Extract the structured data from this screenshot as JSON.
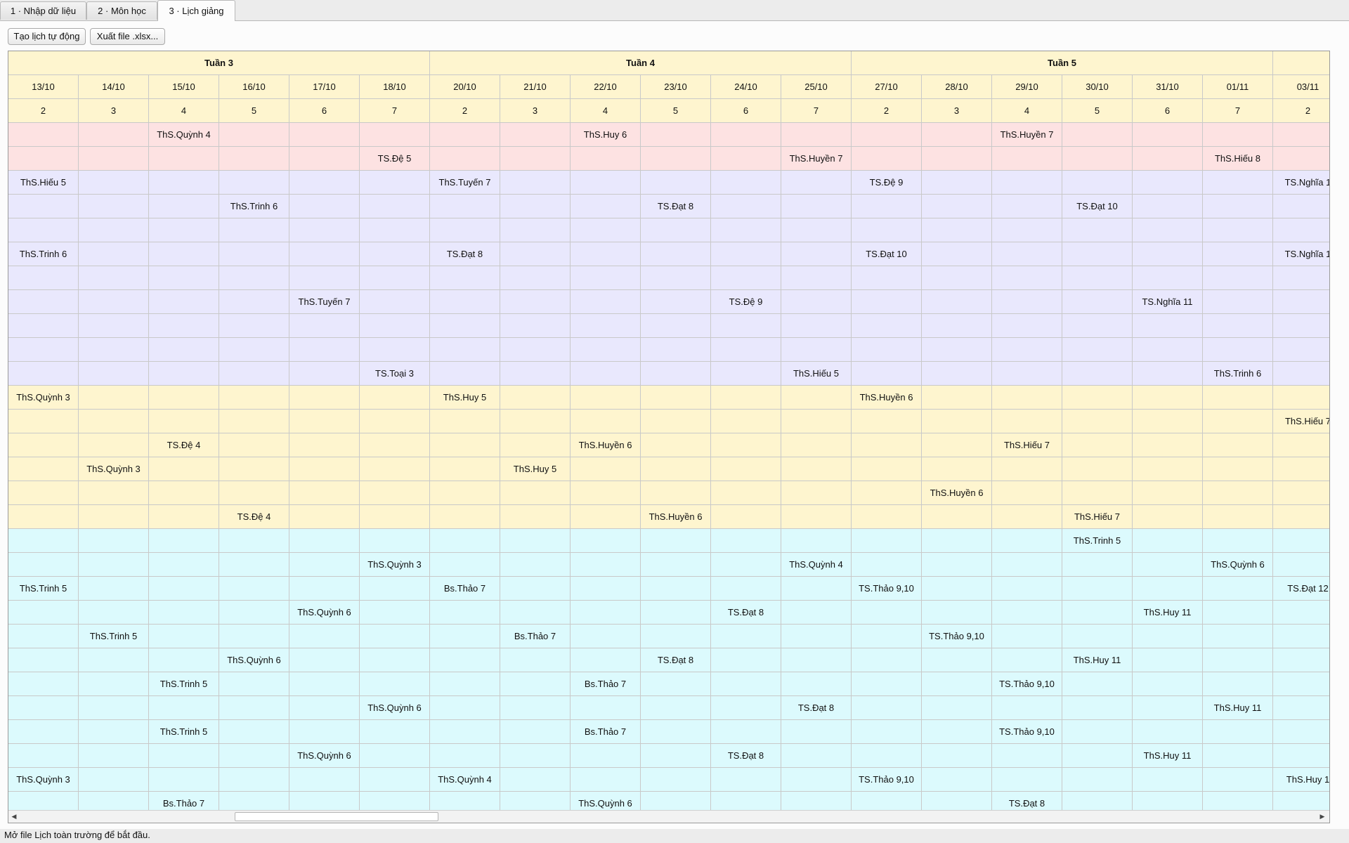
{
  "tabs": [
    {
      "label": "1 · Nhập dữ liệu",
      "active": false
    },
    {
      "label": "2 · Môn học",
      "active": false
    },
    {
      "label": "3 · Lịch giảng",
      "active": true
    }
  ],
  "toolbar": {
    "generate_label": "Tạo lịch tự động",
    "export_label": "Xuất file .xlsx..."
  },
  "schedule": {
    "weeks": [
      "Tuần 3",
      "Tuần 4",
      "Tuần 5"
    ],
    "columns": [
      {
        "date": "13/10",
        "day": "2"
      },
      {
        "date": "14/10",
        "day": "3"
      },
      {
        "date": "15/10",
        "day": "4"
      },
      {
        "date": "16/10",
        "day": "5"
      },
      {
        "date": "17/10",
        "day": "6"
      },
      {
        "date": "18/10",
        "day": "7"
      },
      {
        "date": "20/10",
        "day": "2"
      },
      {
        "date": "21/10",
        "day": "3"
      },
      {
        "date": "22/10",
        "day": "4"
      },
      {
        "date": "23/10",
        "day": "5"
      },
      {
        "date": "24/10",
        "day": "6"
      },
      {
        "date": "25/10",
        "day": "7"
      },
      {
        "date": "27/10",
        "day": "2"
      },
      {
        "date": "28/10",
        "day": "3"
      },
      {
        "date": "29/10",
        "day": "4"
      },
      {
        "date": "30/10",
        "day": "5"
      },
      {
        "date": "31/10",
        "day": "6"
      },
      {
        "date": "01/11",
        "day": "7"
      },
      {
        "date": "03/11",
        "day": "2"
      }
    ],
    "row_groups": [
      {
        "color": "#fde2e2",
        "rows": [
          [
            "",
            "",
            "ThS.Quỳnh 4",
            "",
            "",
            "",
            "",
            "",
            "ThS.Huy 6",
            "",
            "",
            "",
            "",
            "",
            "ThS.Huyền 7",
            "",
            "",
            "",
            ""
          ],
          [
            "",
            "",
            "",
            "",
            "",
            "TS.Đệ 5",
            "",
            "",
            "",
            "",
            "",
            "ThS.Huyền 7",
            "",
            "",
            "",
            "",
            "",
            "ThS.Hiếu 8",
            ""
          ]
        ]
      },
      {
        "color": "#e9e8fd",
        "rows": [
          [
            "ThS.Hiếu 5",
            "",
            "",
            "",
            "",
            "",
            "ThS.Tuyến 7",
            "",
            "",
            "",
            "",
            "",
            "TS.Đệ 9",
            "",
            "",
            "",
            "",
            "",
            "TS.Nghĩa 1"
          ],
          [
            "",
            "",
            "",
            "ThS.Trinh 6",
            "",
            "",
            "",
            "",
            "",
            "TS.Đạt 8",
            "",
            "",
            "",
            "",
            "",
            "TS.Đạt 10",
            "",
            "",
            ""
          ],
          [
            "",
            "",
            "",
            "",
            "",
            "",
            "",
            "",
            "",
            "",
            "",
            "",
            "",
            "",
            "",
            "",
            "",
            "",
            ""
          ],
          [
            "ThS.Trinh 6",
            "",
            "",
            "",
            "",
            "",
            "TS.Đạt 8",
            "",
            "",
            "",
            "",
            "",
            "TS.Đạt 10",
            "",
            "",
            "",
            "",
            "",
            "TS.Nghĩa 1"
          ],
          [
            "",
            "",
            "",
            "",
            "",
            "",
            "",
            "",
            "",
            "",
            "",
            "",
            "",
            "",
            "",
            "",
            "",
            "",
            ""
          ],
          [
            "",
            "",
            "",
            "",
            "ThS.Tuyến 7",
            "",
            "",
            "",
            "",
            "",
            "TS.Đệ 9",
            "",
            "",
            "",
            "",
            "",
            "TS.Nghĩa 11",
            "",
            ""
          ],
          [
            "",
            "",
            "",
            "",
            "",
            "",
            "",
            "",
            "",
            "",
            "",
            "",
            "",
            "",
            "",
            "",
            "",
            "",
            ""
          ],
          [
            "",
            "",
            "",
            "",
            "",
            "",
            "",
            "",
            "",
            "",
            "",
            "",
            "",
            "",
            "",
            "",
            "",
            "",
            ""
          ],
          [
            "",
            "",
            "",
            "",
            "",
            "TS.Toại 3",
            "",
            "",
            "",
            "",
            "",
            "ThS.Hiếu 5",
            "",
            "",
            "",
            "",
            "",
            "ThS.Trinh 6",
            ""
          ]
        ]
      },
      {
        "color": "#fef5cf",
        "rows": [
          [
            "ThS.Quỳnh 3",
            "",
            "",
            "",
            "",
            "",
            "ThS.Huy 5",
            "",
            "",
            "",
            "",
            "",
            "ThS.Huyền 6",
            "",
            "",
            "",
            "",
            "",
            ""
          ],
          [
            "",
            "",
            "",
            "",
            "",
            "",
            "",
            "",
            "",
            "",
            "",
            "",
            "",
            "",
            "",
            "",
            "",
            "",
            "ThS.Hiếu 7"
          ],
          [
            "",
            "",
            "TS.Đệ 4",
            "",
            "",
            "",
            "",
            "",
            "ThS.Huyền 6",
            "",
            "",
            "",
            "",
            "",
            "ThS.Hiếu 7",
            "",
            "",
            "",
            ""
          ],
          [
            "",
            "ThS.Quỳnh 3",
            "",
            "",
            "",
            "",
            "",
            "ThS.Huy 5",
            "",
            "",
            "",
            "",
            "",
            "",
            "",
            "",
            "",
            "",
            ""
          ],
          [
            "",
            "",
            "",
            "",
            "",
            "",
            "",
            "",
            "",
            "",
            "",
            "",
            "",
            "ThS.Huyền 6",
            "",
            "",
            "",
            "",
            ""
          ],
          [
            "",
            "",
            "",
            "TS.Đệ 4",
            "",
            "",
            "",
            "",
            "",
            "ThS.Huyền 6",
            "",
            "",
            "",
            "",
            "",
            "ThS.Hiếu 7",
            "",
            "",
            ""
          ]
        ]
      },
      {
        "color": "#dcfafd",
        "rows": [
          [
            "",
            "",
            "",
            "",
            "",
            "",
            "",
            "",
            "",
            "",
            "",
            "",
            "",
            "",
            "",
            "ThS.Trinh 5",
            "",
            "",
            ""
          ],
          [
            "",
            "",
            "",
            "",
            "",
            "ThS.Quỳnh 3",
            "",
            "",
            "",
            "",
            "",
            "ThS.Quỳnh 4",
            "",
            "",
            "",
            "",
            "",
            "ThS.Quỳnh 6",
            ""
          ],
          [
            "ThS.Trinh 5",
            "",
            "",
            "",
            "",
            "",
            "Bs.Thảo 7",
            "",
            "",
            "",
            "",
            "",
            "TS.Thảo 9,10",
            "",
            "",
            "",
            "",
            "",
            "TS.Đạt 12"
          ],
          [
            "",
            "",
            "",
            "",
            "ThS.Quỳnh 6",
            "",
            "",
            "",
            "",
            "",
            "TS.Đạt 8",
            "",
            "",
            "",
            "",
            "",
            "ThS.Huy 11",
            "",
            ""
          ],
          [
            "",
            "ThS.Trinh 5",
            "",
            "",
            "",
            "",
            "",
            "Bs.Thảo 7",
            "",
            "",
            "",
            "",
            "",
            "TS.Thảo 9,10",
            "",
            "",
            "",
            "",
            ""
          ],
          [
            "",
            "",
            "",
            "ThS.Quỳnh 6",
            "",
            "",
            "",
            "",
            "",
            "TS.Đạt 8",
            "",
            "",
            "",
            "",
            "",
            "ThS.Huy 11",
            "",
            "",
            ""
          ],
          [
            "",
            "",
            "ThS.Trinh 5",
            "",
            "",
            "",
            "",
            "",
            "Bs.Thảo 7",
            "",
            "",
            "",
            "",
            "",
            "TS.Thảo 9,10",
            "",
            "",
            "",
            ""
          ],
          [
            "",
            "",
            "",
            "",
            "",
            "ThS.Quỳnh 6",
            "",
            "",
            "",
            "",
            "",
            "TS.Đạt 8",
            "",
            "",
            "",
            "",
            "",
            "ThS.Huy 11",
            ""
          ],
          [
            "",
            "",
            "ThS.Trinh 5",
            "",
            "",
            "",
            "",
            "",
            "Bs.Thảo 7",
            "",
            "",
            "",
            "",
            "",
            "TS.Thảo 9,10",
            "",
            "",
            "",
            ""
          ],
          [
            "",
            "",
            "",
            "",
            "ThS.Quỳnh 6",
            "",
            "",
            "",
            "",
            "",
            "TS.Đạt 8",
            "",
            "",
            "",
            "",
            "",
            "ThS.Huy 11",
            "",
            ""
          ],
          [
            "ThS.Quỳnh 3",
            "",
            "",
            "",
            "",
            "",
            "ThS.Quỳnh 4",
            "",
            "",
            "",
            "",
            "",
            "TS.Thảo 9,10",
            "",
            "",
            "",
            "",
            "",
            "ThS.Huy 1"
          ],
          [
            "",
            "",
            "Bs.Thảo 7",
            "",
            "",
            "",
            "",
            "",
            "ThS.Quỳnh 6",
            "",
            "",
            "",
            "",
            "",
            "TS.Đạt 8",
            "",
            "",
            "",
            ""
          ]
        ]
      }
    ]
  },
  "status_bar": {
    "text": "Mở file Lịch toàn trường để bắt đầu."
  },
  "icons": {
    "scroll_up": "▲",
    "scroll_down": "▼",
    "scroll_left": "◀",
    "scroll_right": "▶"
  }
}
